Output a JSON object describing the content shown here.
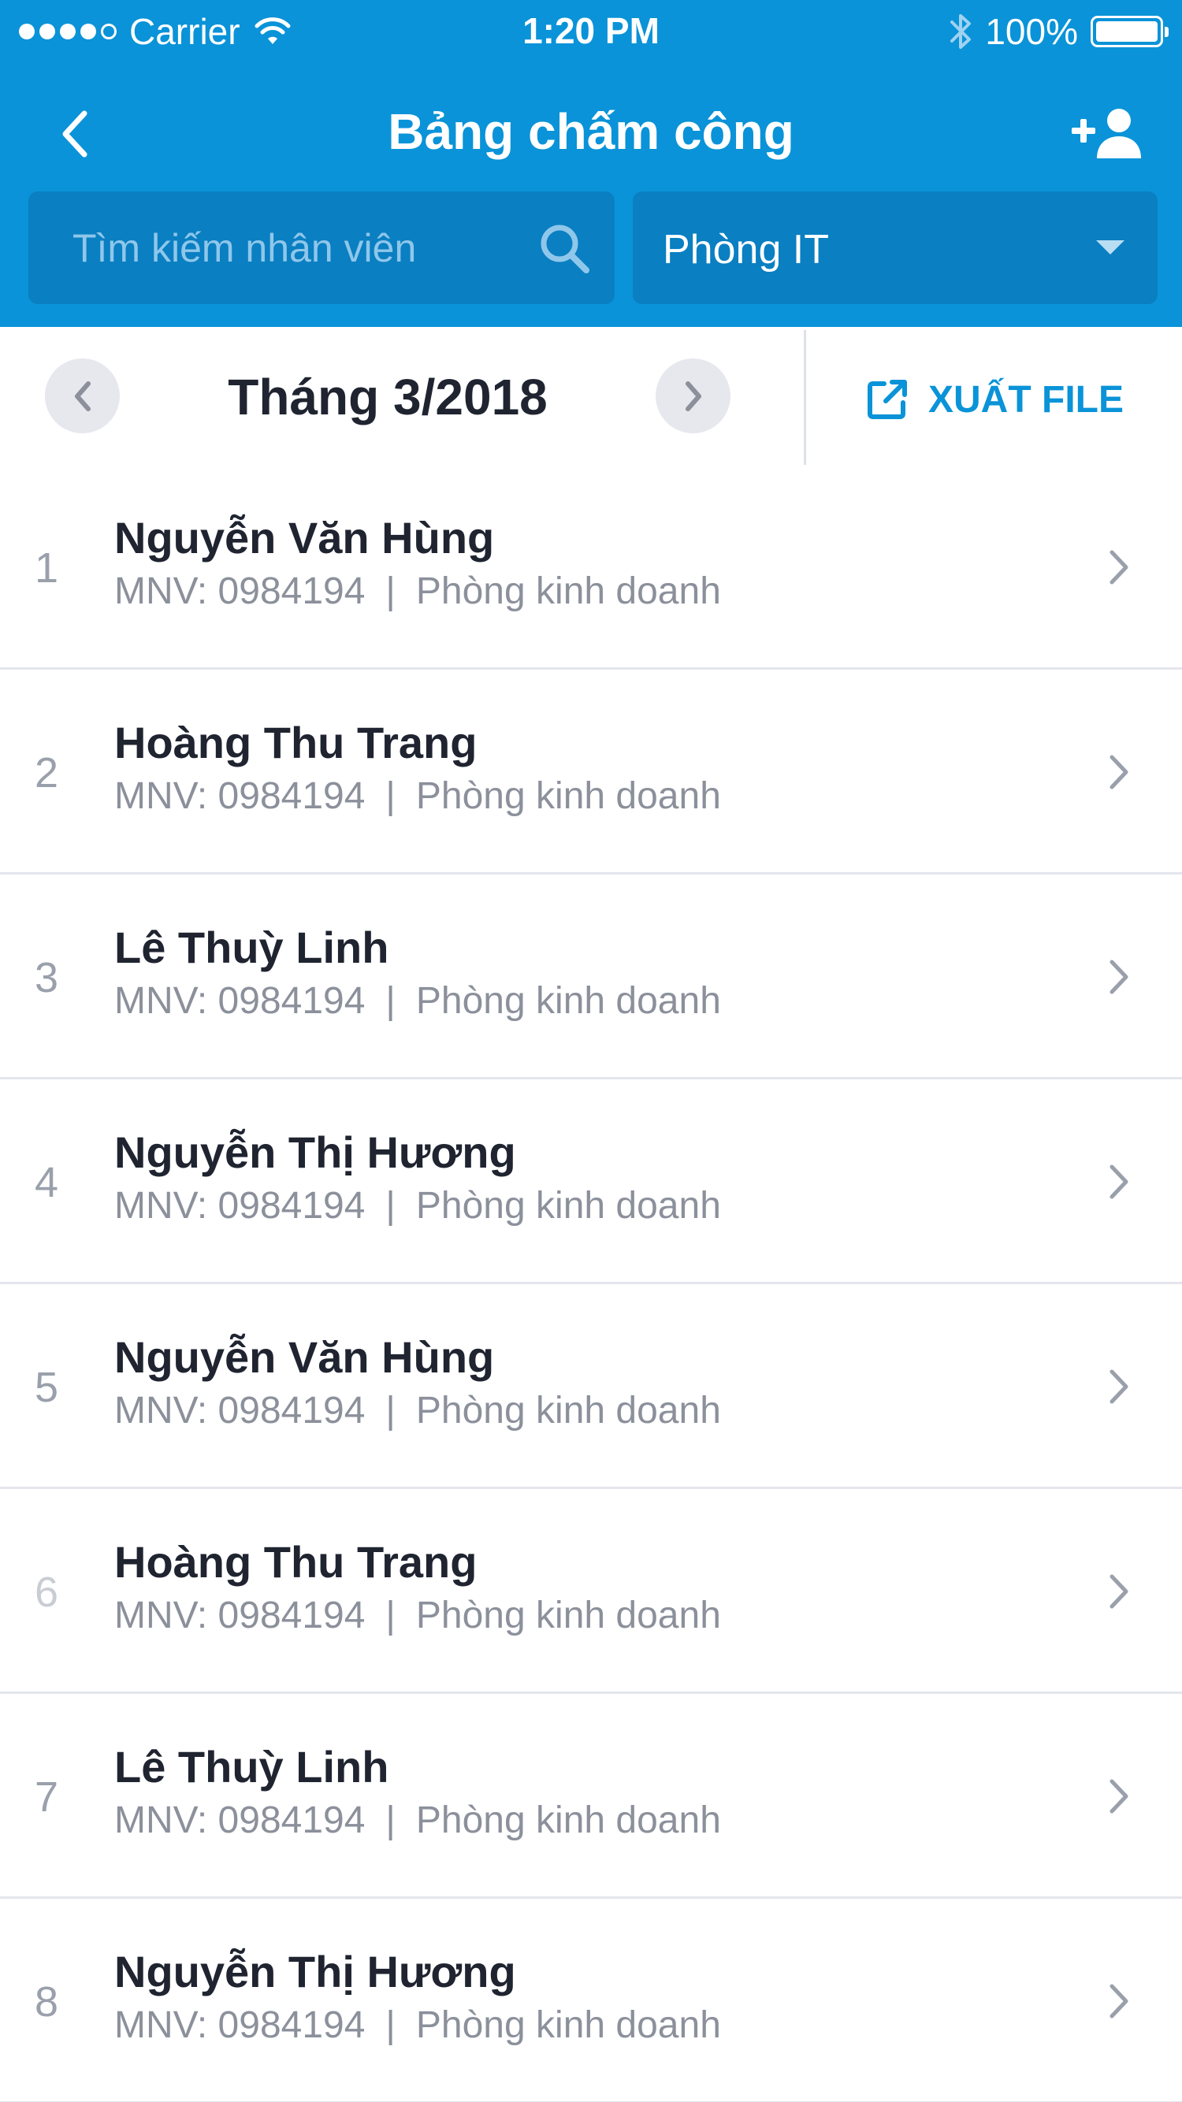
{
  "status_bar": {
    "carrier": "Carrier",
    "time": "1:20 PM",
    "battery": "100%",
    "battery_level": 1.0
  },
  "nav": {
    "title": "Bảng chấm công",
    "back_icon": "chevron-left-icon",
    "add_icon": "add-user-icon"
  },
  "search": {
    "placeholder": "Tìm kiếm nhân viên",
    "value": ""
  },
  "department_filter": {
    "selected": "Phòng IT"
  },
  "month_bar": {
    "label": "Tháng 3/2018",
    "export_label": "XUẤT FILE"
  },
  "employees": [
    {
      "index": "1",
      "name": "Nguyễn Văn Hùng",
      "code": "MNV: 0984194",
      "sep": "|",
      "department": "Phòng kinh doanh"
    },
    {
      "index": "2",
      "name": "Hoàng Thu Trang",
      "code": "MNV: 0984194",
      "sep": "|",
      "department": "Phòng kinh doanh"
    },
    {
      "index": "3",
      "name": "Lê Thuỳ Linh",
      "code": "MNV: 0984194",
      "sep": "|",
      "department": "Phòng kinh doanh"
    },
    {
      "index": "4",
      "name": "Nguyễn Thị Hương",
      "code": "MNV: 0984194",
      "sep": "|",
      "department": "Phòng kinh doanh"
    },
    {
      "index": "5",
      "name": "Nguyễn Văn Hùng",
      "code": "MNV: 0984194",
      "sep": "|",
      "department": "Phòng kinh doanh"
    },
    {
      "index": "6",
      "name": "Hoàng Thu Trang",
      "code": "MNV: 0984194",
      "sep": "|",
      "department": "Phòng kinh doanh"
    },
    {
      "index": "7",
      "name": "Lê Thuỳ Linh",
      "code": "MNV: 0984194",
      "sep": "|",
      "department": "Phòng kinh doanh"
    },
    {
      "index": "8",
      "name": "Nguyễn Thị Hương",
      "code": "MNV: 0984194",
      "sep": "|",
      "department": "Phòng kinh doanh"
    }
  ],
  "colors": {
    "primary": "#0a93d8",
    "input_bg": "#0a7fc2",
    "text_dark": "#1f2430",
    "text_muted": "#8b909b",
    "divider": "#e3e6ec"
  }
}
